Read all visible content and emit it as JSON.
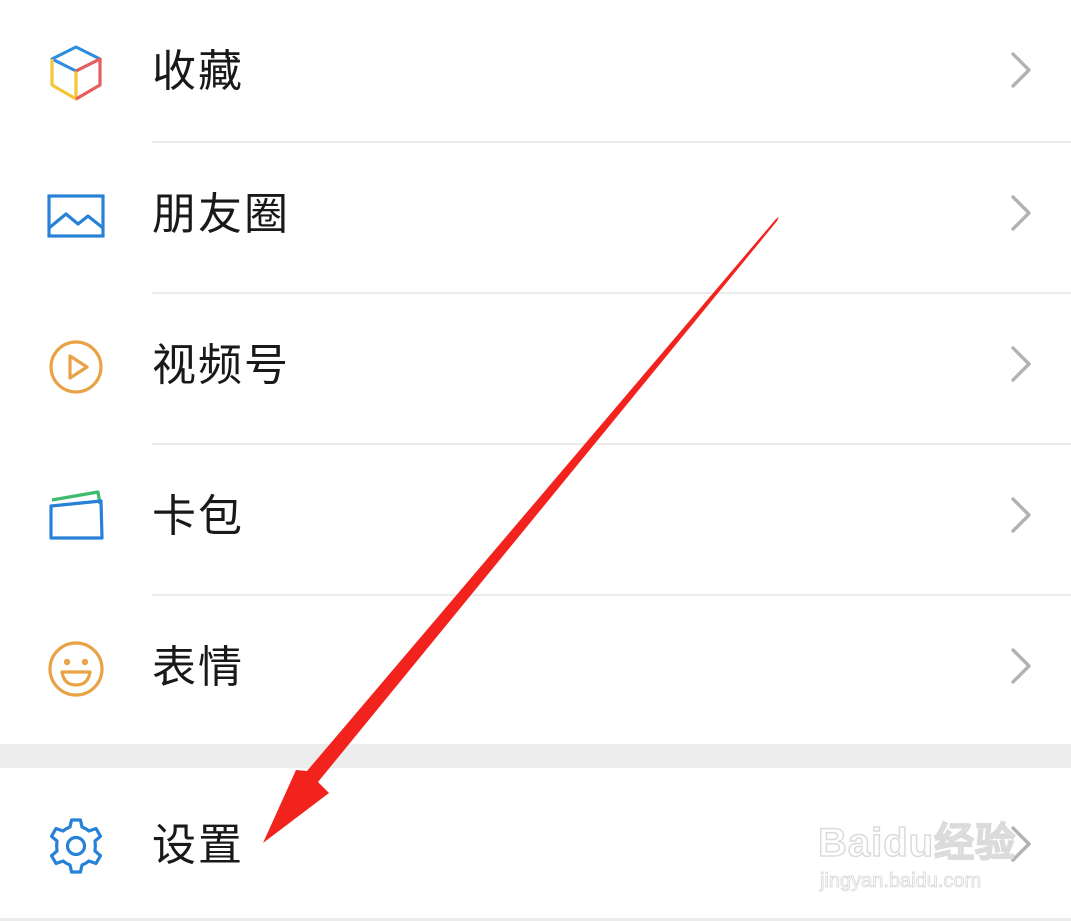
{
  "menu": {
    "items": [
      {
        "label": "收藏",
        "icon": "favorites-cube-icon"
      },
      {
        "label": "朋友圈",
        "icon": "moments-image-icon"
      },
      {
        "label": "视频号",
        "icon": "channels-play-icon"
      },
      {
        "label": "卡包",
        "icon": "card-wallet-icon"
      },
      {
        "label": "表情",
        "icon": "sticker-smiley-icon"
      }
    ],
    "settings": {
      "label": "设置",
      "icon": "gear-icon"
    }
  },
  "watermark": {
    "logo": "Baidu经验",
    "url": "jingyan.baidu.com"
  },
  "colors": {
    "label_text": "#191919",
    "chevron": "#b2b2b2",
    "divider": "#ececec",
    "section_gap": "#ededed",
    "arrow": "#f2231c",
    "icon_blue": "#2782d7",
    "icon_orange": "#e9a246",
    "icon_green": "#3fba6e",
    "icon_red": "#e95d5d",
    "icon_yellow": "#f5c53c"
  }
}
